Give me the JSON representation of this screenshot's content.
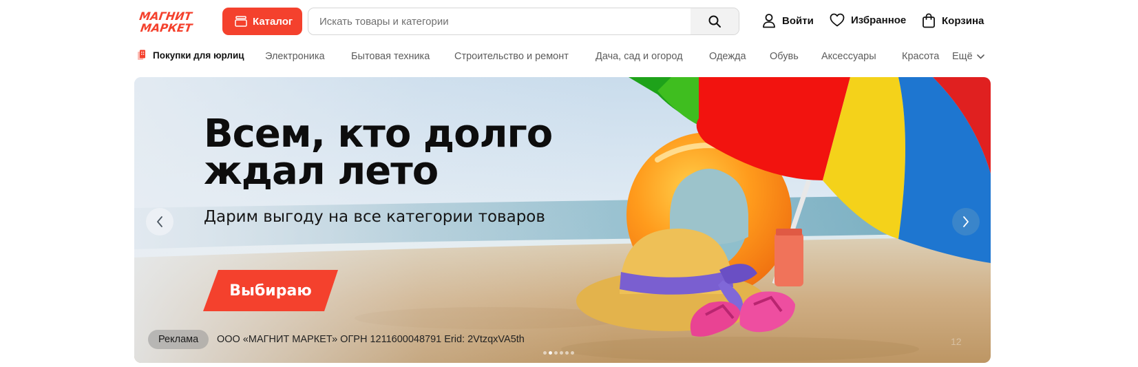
{
  "header": {
    "logo_line1": "МАГНИТ",
    "logo_line2": "МАРКЕТ",
    "catalog_label": "Каталог",
    "search_placeholder": "Искать товары и категории",
    "search_icon": "search-icon",
    "login_label": "Войти",
    "favorites_label": "Избранное",
    "cart_label": "Корзина"
  },
  "nav": {
    "b2b_label": "Покупки для юрлиц",
    "items": [
      "Электроника",
      "Бытовая техника",
      "Строительство и ремонт",
      "Дача, сад и огород",
      "Одежда",
      "Обувь",
      "Аксессуары",
      "Красота"
    ],
    "more_label": "Ещё"
  },
  "banner": {
    "headline_line1": "Всем, кто долго",
    "headline_line2": "ждал лето",
    "subline": "Дарим выгоду на все категории товаров",
    "cta_label": "Выбираю",
    "ad_label": "Реклама",
    "legal_text": "ООО «МАГНИТ МАРКЕТ» ОГРН 1211600048791 Erid: 2VtzqxVA5th",
    "slide_counter": "12",
    "slides_total": 6,
    "active_slide": 1
  },
  "colors": {
    "brand_red": "#f4412d",
    "text_dark": "#111111",
    "nav_gray": "#5c5c5c"
  }
}
